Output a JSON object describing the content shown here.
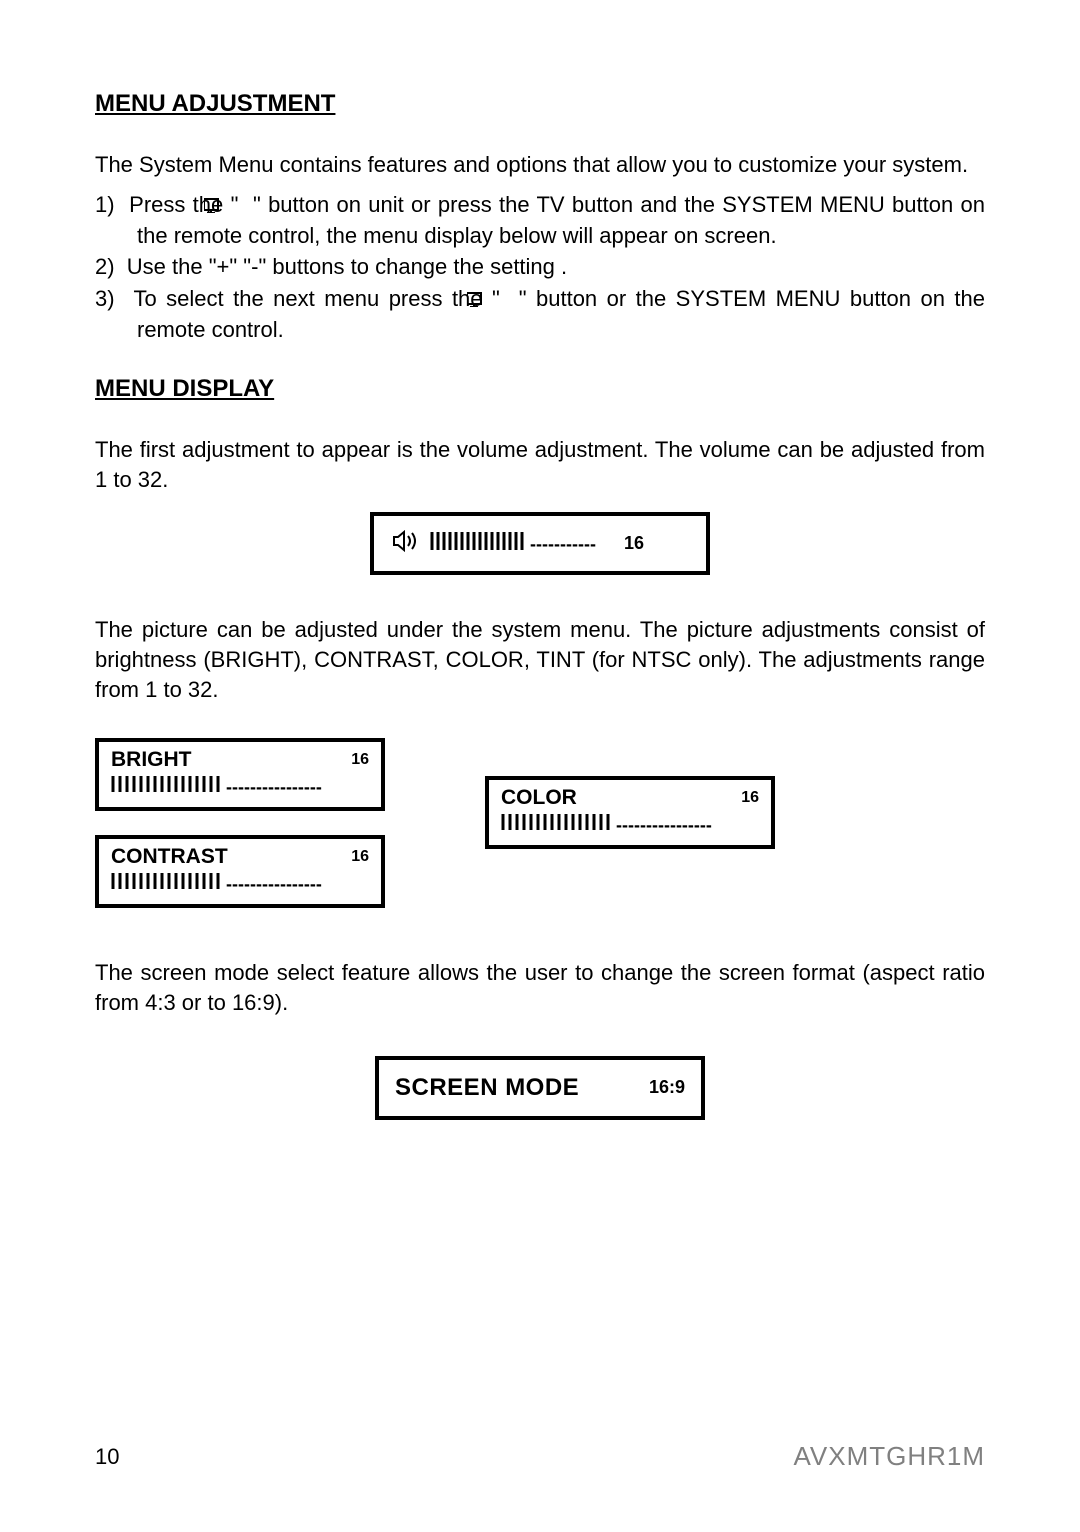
{
  "headings": {
    "menu_adjustment": "MENU ADJUSTMENT",
    "menu_display": "MENU DISPLAY"
  },
  "intro": "The System Menu contains features and options that allow you to customize your system.",
  "steps": [
    {
      "num": "1)",
      "pre": "Press the \" ",
      "post": " \" button on unit or  press the TV button and the SYSTEM MENU button on the remote control, the menu display below will appear on screen."
    },
    {
      "num": "2)",
      "text": "Use the \"+\"  \"-\" buttons  to change the setting ."
    },
    {
      "num": "3)",
      "pre": "To select the next menu press  the \" ",
      "post": " \" button or the SYSTEM MENU button on the remote control."
    }
  ],
  "volume_text": "The first adjustment to appear is the volume adjustment. The volume can be adjusted from 1 to 32.",
  "volume": {
    "value": "16"
  },
  "picture_text": "The picture can be adjusted under the system menu. The picture adjustments consist of brightness (BRIGHT), CONTRAST, COLOR, TINT (for NTSC only). The adjustments range from 1 to 32.",
  "adjustments": {
    "bright": {
      "label": "BRIGHT",
      "value": "16"
    },
    "contrast": {
      "label": "CONTRAST",
      "value": "16"
    },
    "color": {
      "label": "COLOR",
      "value": "16"
    }
  },
  "screen_mode_text": "The screen mode select feature allows the user to change the screen format (aspect ratio from 4:3 or to 16:9).",
  "screen_mode": {
    "label": "SCREEN MODE",
    "value": "16:9"
  },
  "footer": {
    "page": "10",
    "model": "AVXMTGHR1M"
  }
}
